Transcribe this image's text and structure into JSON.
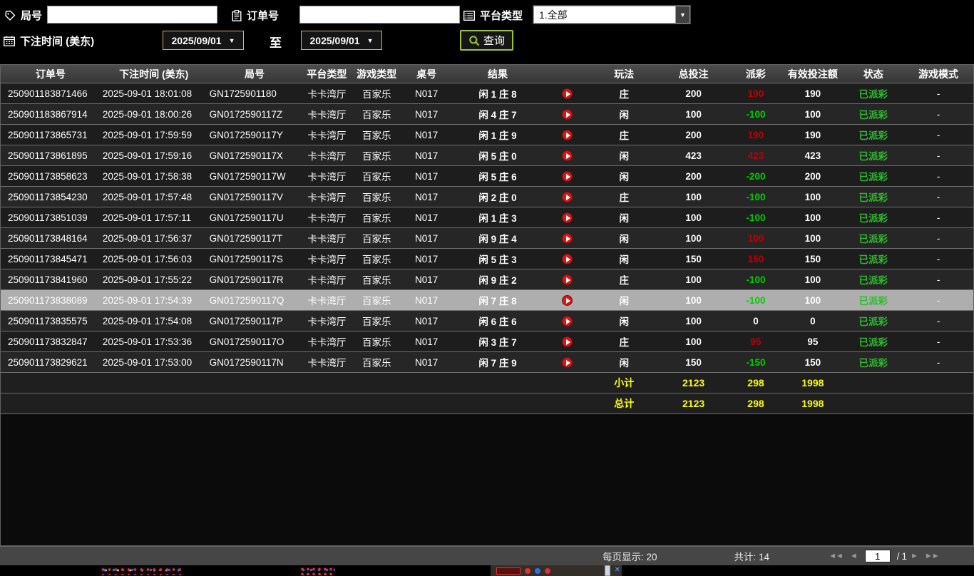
{
  "filters": {
    "round": {
      "label": "局号",
      "value": "",
      "icon": "tag-icon"
    },
    "order": {
      "label": "订单号",
      "value": "",
      "icon": "clipboard-icon"
    },
    "platform": {
      "label": "平台类型",
      "value": "1.全部",
      "icon": "list-icon"
    },
    "bet_time": {
      "label": "下注时间 (美东)",
      "icon": "calendar-icon",
      "from": "2025/09/01",
      "to_label": "至",
      "to": "2025/09/01"
    },
    "search_label": "查询",
    "dropdown_caret": "▼"
  },
  "table": {
    "columns": [
      "订单号",
      "下注时间 (美东)",
      "局号",
      "平台类型",
      "游戏类型",
      "桌号",
      "结果",
      "",
      "玩法",
      "总投注",
      "派彩",
      "有效投注额",
      "状态",
      "游戏模式"
    ],
    "rows": [
      {
        "order": "250901183871466",
        "time": "2025-09-01 18:01:08",
        "round": "GN1725901180",
        "platform": "卡卡湾厅",
        "game": "百家乐",
        "table_no": "N017",
        "result": "闲 1 庄 8",
        "play": "庄",
        "total": "200",
        "payout": "190",
        "payout_class": "win",
        "valid": "190",
        "status": "已派彩",
        "mode": "-",
        "selected": false
      },
      {
        "order": "250901183867914",
        "time": "2025-09-01 18:00:26",
        "round": "GN0172590117Z",
        "platform": "卡卡湾厅",
        "game": "百家乐",
        "table_no": "N017",
        "result": "闲 4 庄 7",
        "play": "闲",
        "total": "100",
        "payout": "-100",
        "payout_class": "loss",
        "valid": "100",
        "status": "已派彩",
        "mode": "-",
        "selected": false
      },
      {
        "order": "250901173865731",
        "time": "2025-09-01 17:59:59",
        "round": "GN0172590117Y",
        "platform": "卡卡湾厅",
        "game": "百家乐",
        "table_no": "N017",
        "result": "闲 1 庄 9",
        "play": "庄",
        "total": "200",
        "payout": "190",
        "payout_class": "win",
        "valid": "190",
        "status": "已派彩",
        "mode": "-",
        "selected": false
      },
      {
        "order": "250901173861895",
        "time": "2025-09-01 17:59:16",
        "round": "GN0172590117X",
        "platform": "卡卡湾厅",
        "game": "百家乐",
        "table_no": "N017",
        "result": "闲 5 庄 0",
        "play": "闲",
        "total": "423",
        "payout": "423",
        "payout_class": "win",
        "valid": "423",
        "status": "已派彩",
        "mode": "-",
        "selected": false
      },
      {
        "order": "250901173858623",
        "time": "2025-09-01 17:58:38",
        "round": "GN0172590117W",
        "platform": "卡卡湾厅",
        "game": "百家乐",
        "table_no": "N017",
        "result": "闲 5 庄 6",
        "play": "闲",
        "total": "200",
        "payout": "-200",
        "payout_class": "loss",
        "valid": "200",
        "status": "已派彩",
        "mode": "-",
        "selected": false
      },
      {
        "order": "250901173854230",
        "time": "2025-09-01 17:57:48",
        "round": "GN0172590117V",
        "platform": "卡卡湾厅",
        "game": "百家乐",
        "table_no": "N017",
        "result": "闲 2 庄 0",
        "play": "庄",
        "total": "100",
        "payout": "-100",
        "payout_class": "loss",
        "valid": "100",
        "status": "已派彩",
        "mode": "-",
        "selected": false
      },
      {
        "order": "250901173851039",
        "time": "2025-09-01 17:57:11",
        "round": "GN0172590117U",
        "platform": "卡卡湾厅",
        "game": "百家乐",
        "table_no": "N017",
        "result": "闲 1 庄 3",
        "play": "闲",
        "total": "100",
        "payout": "-100",
        "payout_class": "loss",
        "valid": "100",
        "status": "已派彩",
        "mode": "-",
        "selected": false
      },
      {
        "order": "250901173848164",
        "time": "2025-09-01 17:56:37",
        "round": "GN0172590117T",
        "platform": "卡卡湾厅",
        "game": "百家乐",
        "table_no": "N017",
        "result": "闲 9 庄 4",
        "play": "闲",
        "total": "100",
        "payout": "100",
        "payout_class": "win",
        "valid": "100",
        "status": "已派彩",
        "mode": "-",
        "selected": false
      },
      {
        "order": "250901173845471",
        "time": "2025-09-01 17:56:03",
        "round": "GN0172590117S",
        "platform": "卡卡湾厅",
        "game": "百家乐",
        "table_no": "N017",
        "result": "闲 5 庄 3",
        "play": "闲",
        "total": "150",
        "payout": "150",
        "payout_class": "win",
        "valid": "150",
        "status": "已派彩",
        "mode": "-",
        "selected": false
      },
      {
        "order": "250901173841960",
        "time": "2025-09-01 17:55:22",
        "round": "GN0172590117R",
        "platform": "卡卡湾厅",
        "game": "百家乐",
        "table_no": "N017",
        "result": "闲 9 庄 2",
        "play": "庄",
        "total": "100",
        "payout": "-100",
        "payout_class": "loss",
        "valid": "100",
        "status": "已派彩",
        "mode": "-",
        "selected": false
      },
      {
        "order": "250901173838089",
        "time": "2025-09-01 17:54:39",
        "round": "GN0172590117Q",
        "platform": "卡卡湾厅",
        "game": "百家乐",
        "table_no": "N017",
        "result": "闲 7 庄 8",
        "play": "闲",
        "total": "100",
        "payout": "-100",
        "payout_class": "loss",
        "valid": "100",
        "status": "已派彩",
        "mode": "-",
        "selected": true
      },
      {
        "order": "250901173835575",
        "time": "2025-09-01 17:54:08",
        "round": "GN0172590117P",
        "platform": "卡卡湾厅",
        "game": "百家乐",
        "table_no": "N017",
        "result": "闲 6 庄 6",
        "play": "闲",
        "total": "100",
        "payout": "0",
        "payout_class": "zero",
        "valid": "0",
        "status": "已派彩",
        "mode": "-",
        "selected": false
      },
      {
        "order": "250901173832847",
        "time": "2025-09-01 17:53:36",
        "round": "GN0172590117O",
        "platform": "卡卡湾厅",
        "game": "百家乐",
        "table_no": "N017",
        "result": "闲 3 庄 7",
        "play": "庄",
        "total": "100",
        "payout": "95",
        "payout_class": "win",
        "valid": "95",
        "status": "已派彩",
        "mode": "-",
        "selected": false
      },
      {
        "order": "250901173829621",
        "time": "2025-09-01 17:53:00",
        "round": "GN0172590117N",
        "platform": "卡卡湾厅",
        "game": "百家乐",
        "table_no": "N017",
        "result": "闲 7 庄 9",
        "play": "闲",
        "total": "150",
        "payout": "-150",
        "payout_class": "loss",
        "valid": "150",
        "status": "已派彩",
        "mode": "-",
        "selected": false
      }
    ],
    "subtotal": {
      "label": "小计",
      "total": "2123",
      "payout": "298",
      "valid": "1998"
    },
    "grand_total": {
      "label": "总计",
      "total": "2123",
      "payout": "298",
      "valid": "1998"
    }
  },
  "pagination": {
    "per_page_label": "每页显示: 20",
    "total_label": "共计: 14",
    "current_page": "1",
    "slash": "/",
    "total_pages": "1",
    "first_icon": "◄◄",
    "prev_icon": "◄",
    "next_icon": "►",
    "last_icon": "►►"
  },
  "colors": {
    "win_payout": "#c00000",
    "loss_payout": "#00d000",
    "status_paid": "#2fbb2f",
    "summary_text": "#ffff00",
    "selected_row_bg": "#aeaeae",
    "search_button_border": "#9dc62a",
    "date_button_border": "#d2b27a",
    "replay_icon": "#d81616"
  }
}
